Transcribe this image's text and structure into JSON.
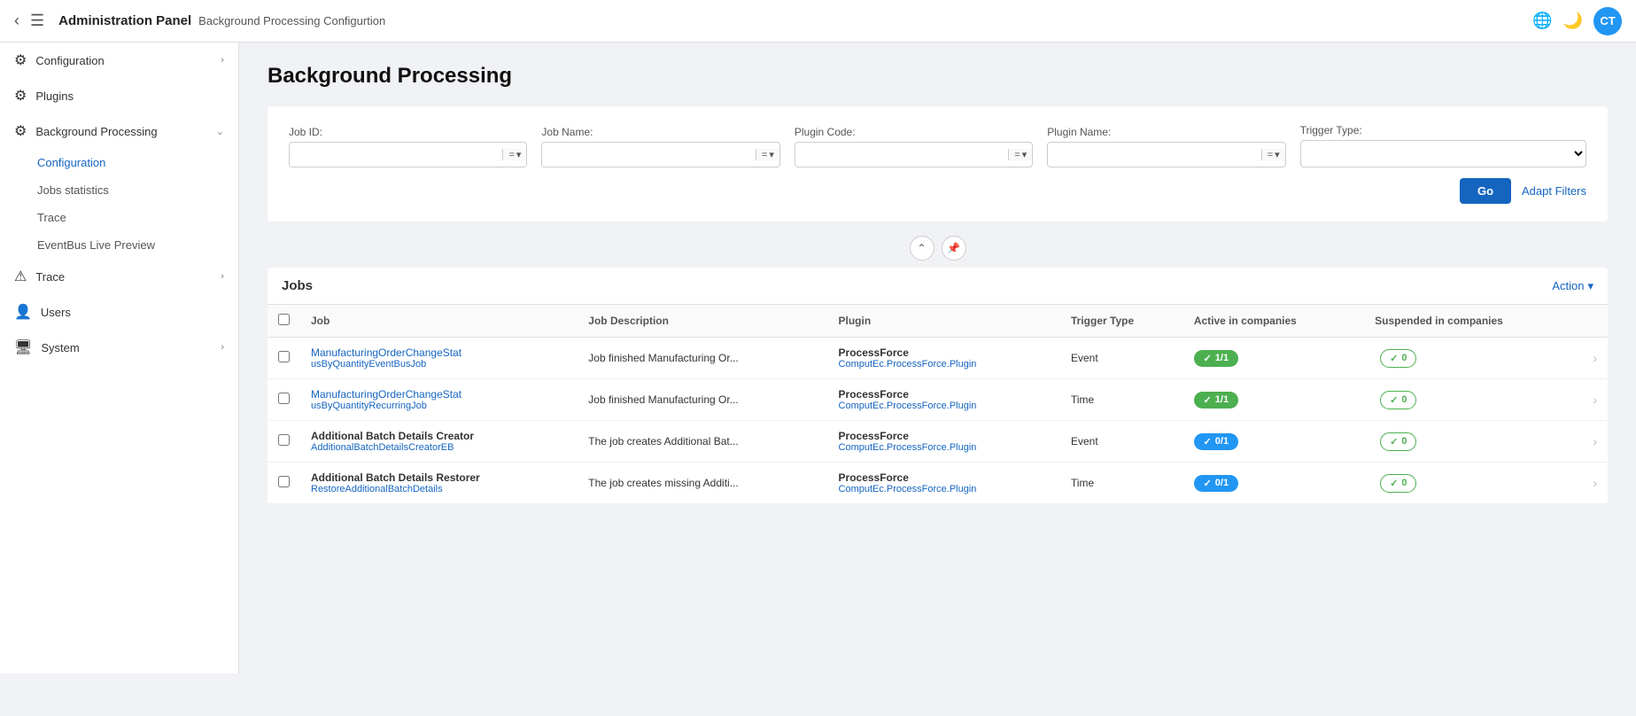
{
  "topbar": {
    "title": "Administration Panel",
    "subtitle": "Background Processing Configurtion",
    "avatar_initials": "CT"
  },
  "sidebar": {
    "items": [
      {
        "id": "configuration",
        "label": "Configuration",
        "icon": "⚙",
        "has_chevron": true,
        "expanded": false
      },
      {
        "id": "plugins",
        "label": "Plugins",
        "icon": "🧩",
        "has_chevron": false
      },
      {
        "id": "background-processing",
        "label": "Background Processing",
        "icon": "⚙",
        "has_chevron": true,
        "expanded": true,
        "children": [
          {
            "id": "bp-configuration",
            "label": "Configuration",
            "active": true
          },
          {
            "id": "bp-jobs-statistics",
            "label": "Jobs statistics"
          },
          {
            "id": "bp-trace",
            "label": "Trace"
          },
          {
            "id": "bp-eventbus",
            "label": "EventBus Live Preview"
          }
        ]
      },
      {
        "id": "trace",
        "label": "Trace",
        "icon": "⚠",
        "has_chevron": true
      },
      {
        "id": "users",
        "label": "Users",
        "icon": "👤",
        "has_chevron": false
      },
      {
        "id": "system",
        "label": "System",
        "icon": "🖥",
        "has_chevron": true
      }
    ]
  },
  "page": {
    "title": "Background Processing"
  },
  "filters": {
    "job_id_label": "Job ID:",
    "job_name_label": "Job Name:",
    "plugin_code_label": "Plugin Code:",
    "plugin_name_label": "Plugin Name:",
    "trigger_type_label": "Trigger Type:",
    "go_label": "Go",
    "adapt_filters_label": "Adapt Filters"
  },
  "jobs_section": {
    "title": "Jobs",
    "action_label": "Action",
    "columns": [
      "Job",
      "Job Description",
      "Plugin",
      "Trigger Type",
      "Active in companies",
      "Suspended in companies"
    ],
    "rows": [
      {
        "job_primary": "ManufacturingOrderChangeStat",
        "job_secondary_1": "usByQuantityEventBusJob",
        "job_sub": "",
        "description": "Job finished Manufacturing Or...",
        "plugin_name": "ProcessForce",
        "plugin_code": "ComputEc.ProcessForce.Plugin",
        "trigger_type": "Event",
        "active_count": "1/1",
        "active_badge": "green",
        "suspended_count": "0",
        "suspended_badge": "green",
        "bold": false
      },
      {
        "job_primary": "ManufacturingOrderChangeStat",
        "job_secondary_1": "usByQuantityRecurringJob",
        "job_sub": "",
        "description": "Job finished Manufacturing Or...",
        "plugin_name": "ProcessForce",
        "plugin_code": "ComputEc.ProcessForce.Plugin",
        "trigger_type": "Time",
        "active_count": "1/1",
        "active_badge": "green",
        "suspended_count": "0",
        "suspended_badge": "green",
        "bold": false
      },
      {
        "job_primary": "Additional Batch Details Creator",
        "job_secondary_1": "",
        "job_sub": "AdditionalBatchDetailsCreatorEB",
        "description": "The job creates Additional Bat...",
        "plugin_name": "ProcessForce",
        "plugin_code": "ComputEc.ProcessForce.Plugin",
        "trigger_type": "Event",
        "active_count": "0/1",
        "active_badge": "blue",
        "suspended_count": "0",
        "suspended_badge": "green",
        "bold": true
      },
      {
        "job_primary": "Additional Batch Details Restorer",
        "job_secondary_1": "",
        "job_sub": "RestoreAdditionalBatchDetails",
        "description": "The job creates missing Additi...",
        "plugin_name": "ProcessForce",
        "plugin_code": "ComputEc.ProcessForce.Plugin",
        "trigger_type": "Time",
        "active_count": "0/1",
        "active_badge": "blue",
        "suspended_count": "0",
        "suspended_badge": "green",
        "bold": true
      }
    ]
  }
}
